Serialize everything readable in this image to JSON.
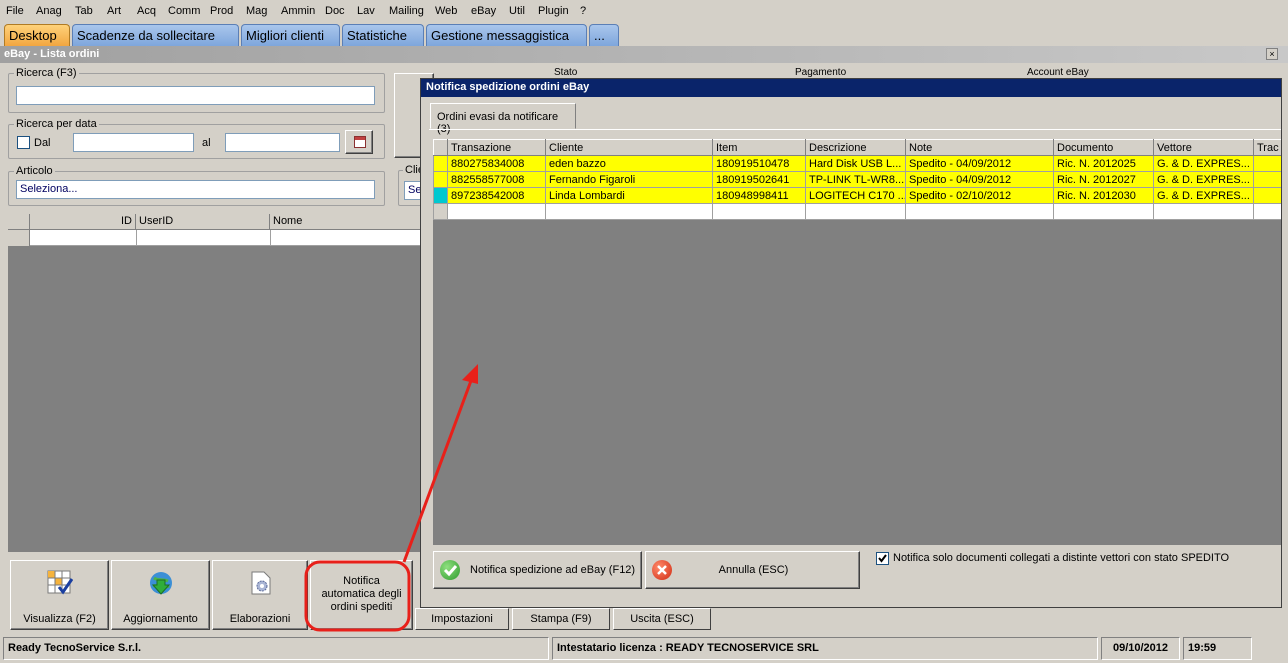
{
  "menu": [
    "File",
    "Anag",
    "Tab",
    "Art",
    "Acq",
    "Comm",
    "Prod",
    "Mag",
    "Ammin",
    "Doc",
    "Lav",
    "Mailing",
    "Web",
    "eBay",
    "Util",
    "Plugin",
    "?"
  ],
  "tabs": [
    "Desktop",
    "Scadenze da sollecitare",
    "Migliori clienti",
    "Statistiche",
    "Gestione messaggistica",
    "..."
  ],
  "window": {
    "title": "eBay - Lista ordini",
    "close": "×"
  },
  "search": {
    "label": "Ricerca (F3)",
    "value": ""
  },
  "date_search": {
    "label": "Ricerca per data",
    "from_label": "Dal",
    "to_label": "al"
  },
  "article": {
    "label": "Articolo",
    "value": "Seleziona..."
  },
  "customer": {
    "label": "Clie",
    "value": "Se"
  },
  "filters": {
    "stato": "Stato",
    "pagamento": "Pagamento",
    "account": "Account eBay"
  },
  "left_grid": {
    "columns": [
      "ID",
      "UserID",
      "Nome"
    ]
  },
  "toolbar": {
    "visualizza": "Visualizza (F2)",
    "aggiornamento": "Aggiornamento",
    "elaborazioni": "Elaborazioni",
    "notifica_line1": "Notifica",
    "notifica_line2": "automatica degli",
    "notifica_line3": "ordini spediti"
  },
  "bottom_buttons": {
    "impostazioni": "Impostazioni",
    "stampa": "Stampa (F9)",
    "uscita": "Uscita (ESC)"
  },
  "dialog": {
    "title": "Notifica spedizione ordini eBay",
    "tab": "Ordini evasi da notificare (3)",
    "columns": [
      "Transazione",
      "Cliente",
      "Item",
      "Descrizione",
      "Note",
      "Documento",
      "Vettore",
      "Trac"
    ],
    "rows": [
      [
        "880275834008",
        "eden bazzo",
        "180919510478",
        "Hard Disk USB L...",
        "Spedito - 04/09/2012",
        "Ric. N. 2012025",
        "G. & D. EXPRES..."
      ],
      [
        "882558577008",
        "Fernando Figaroli",
        "180919502641",
        "TP-LINK TL-WR8...",
        "Spedito - 04/09/2012",
        "Ric. N. 2012027",
        "G. & D. EXPRES..."
      ],
      [
        "897238542008",
        "Linda Lombardi",
        "180948998411",
        "LOGITECH C170 ...",
        "Spedito - 02/10/2012",
        "Ric. N. 2012030",
        "G. & D. EXPRES..."
      ]
    ],
    "notify_button": "Notifica spedizione ad eBay (F12)",
    "cancel_button": "Annulla (ESC)",
    "only_docs_checkbox": "Notifica solo documenti  collegati a distinte vettori con stato SPEDITO"
  },
  "statusbar": {
    "company": "Ready TecnoService S.r.l.",
    "license": "Intestatario licenza : READY TECNOSERVICE SRL",
    "date": "09/10/2012",
    "time": "19:59"
  },
  "colors": {
    "highlight_rows": "#ffff00",
    "annotation": "#e8201a",
    "dialog_title": "#0a246a"
  }
}
